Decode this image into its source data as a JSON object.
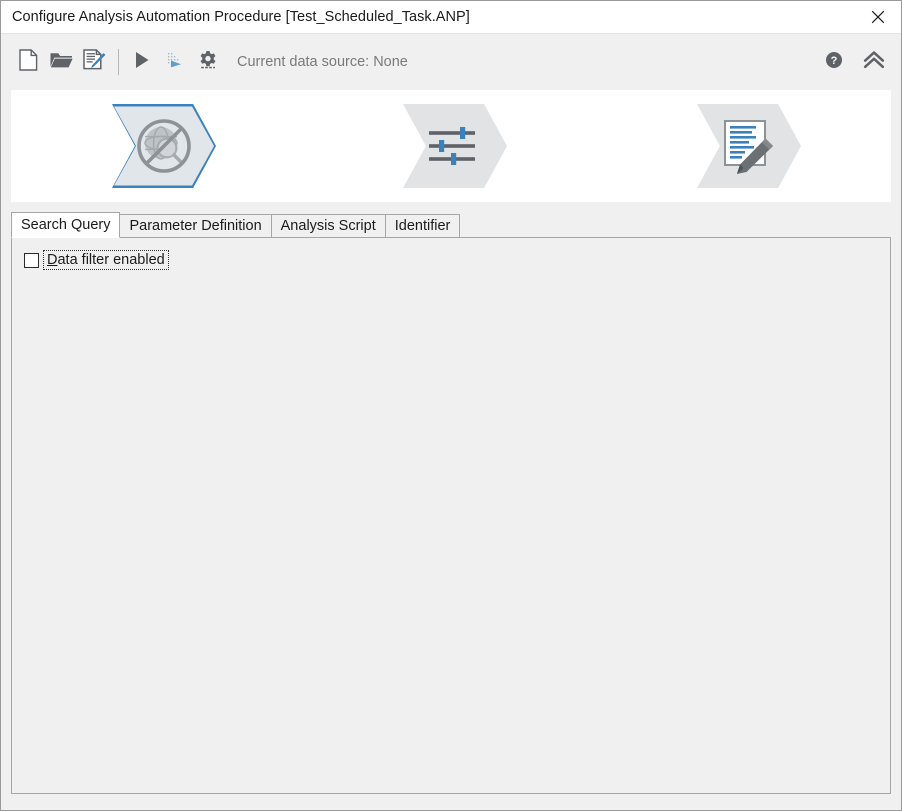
{
  "window": {
    "title": "Configure Analysis Automation Procedure [Test_Scheduled_Task.ANP]",
    "close_icon": "close-icon"
  },
  "toolbar": {
    "buttons": [
      {
        "name": "new-procedure-button",
        "icon": "new-document-icon",
        "label": "New"
      },
      {
        "name": "open-procedure-button",
        "icon": "open-folder-icon",
        "label": "Open"
      },
      {
        "name": "edit-procedure-button",
        "icon": "document-pen-icon",
        "label": "Edit"
      },
      {
        "name": "run-button",
        "icon": "play-icon",
        "label": "Run"
      },
      {
        "name": "step-run-button",
        "icon": "step-run-icon",
        "label": "Step Run"
      },
      {
        "name": "settings-button",
        "icon": "gear-icon",
        "label": "Settings"
      }
    ],
    "status_text": "Current data source: None",
    "help_icon": "help-circle-icon",
    "collapse_icon": "double-chevron-up-icon"
  },
  "wizard": {
    "steps": [
      {
        "name": "step-data-source",
        "icon": "no-data-source-icon",
        "selected": true,
        "label": "Data Source"
      },
      {
        "name": "step-parameters",
        "icon": "sliders-icon",
        "selected": false,
        "label": "Parameters"
      },
      {
        "name": "step-report",
        "icon": "document-edit-icon",
        "selected": false,
        "label": "Report"
      }
    ]
  },
  "tabs": [
    {
      "label": "Search Query",
      "active": true
    },
    {
      "label": "Parameter Definition",
      "active": false
    },
    {
      "label": "Analysis Script",
      "active": false
    },
    {
      "label": "Identifier",
      "active": false
    }
  ],
  "content": {
    "data_filter": {
      "mnemonic": "D",
      "label_rest": "ata filter enabled",
      "checked": false
    }
  },
  "colors": {
    "accent_blue": "#3b82bd",
    "icon_gray": "#5f6368",
    "window_bg": "#f0f0f0",
    "panel_bg": "#f0f0f0",
    "banner_bg": "#ffffff",
    "step_inactive": "#e1e3e5",
    "step_selected_fill": "#e1e6ea",
    "border_gray": "#a6a6a6",
    "status_text": "#7a7a7a"
  }
}
